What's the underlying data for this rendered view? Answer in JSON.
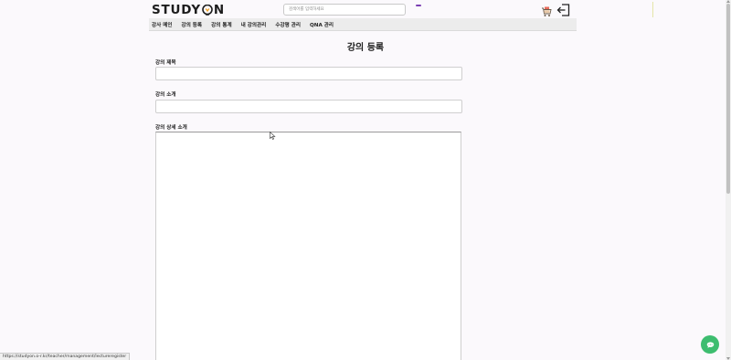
{
  "header": {
    "logo_prefix": "STUDY ",
    "logo_suffix": "N",
    "search_placeholder": "검색어를 입력하세요"
  },
  "nav": {
    "items": [
      {
        "label": "강사 메인"
      },
      {
        "label": "강의 등록"
      },
      {
        "label": "강의 통계"
      },
      {
        "label": "내 강의관리"
      },
      {
        "label": "수강평 관리"
      },
      {
        "label": "QNA 관리"
      }
    ]
  },
  "form": {
    "page_title": "강의 등록",
    "title_label": "강의 제목",
    "title_value": "",
    "intro_label": "강의 소개",
    "intro_value": "",
    "detail_label": "강의 상세 소개",
    "detail_value": ""
  },
  "status_bar": {
    "url": "https://studyon.o-r.kr/teacher/management/lectureregister"
  },
  "colors": {
    "accent_purple": "#7b3fb3",
    "chat_green": "#3dbd6f",
    "logo_bulb_orange": "#f0a020"
  },
  "icons": {
    "cart": "cart-icon",
    "logout": "logout-icon",
    "chat": "chat-icon",
    "cursor": "mouse-cursor-icon"
  }
}
